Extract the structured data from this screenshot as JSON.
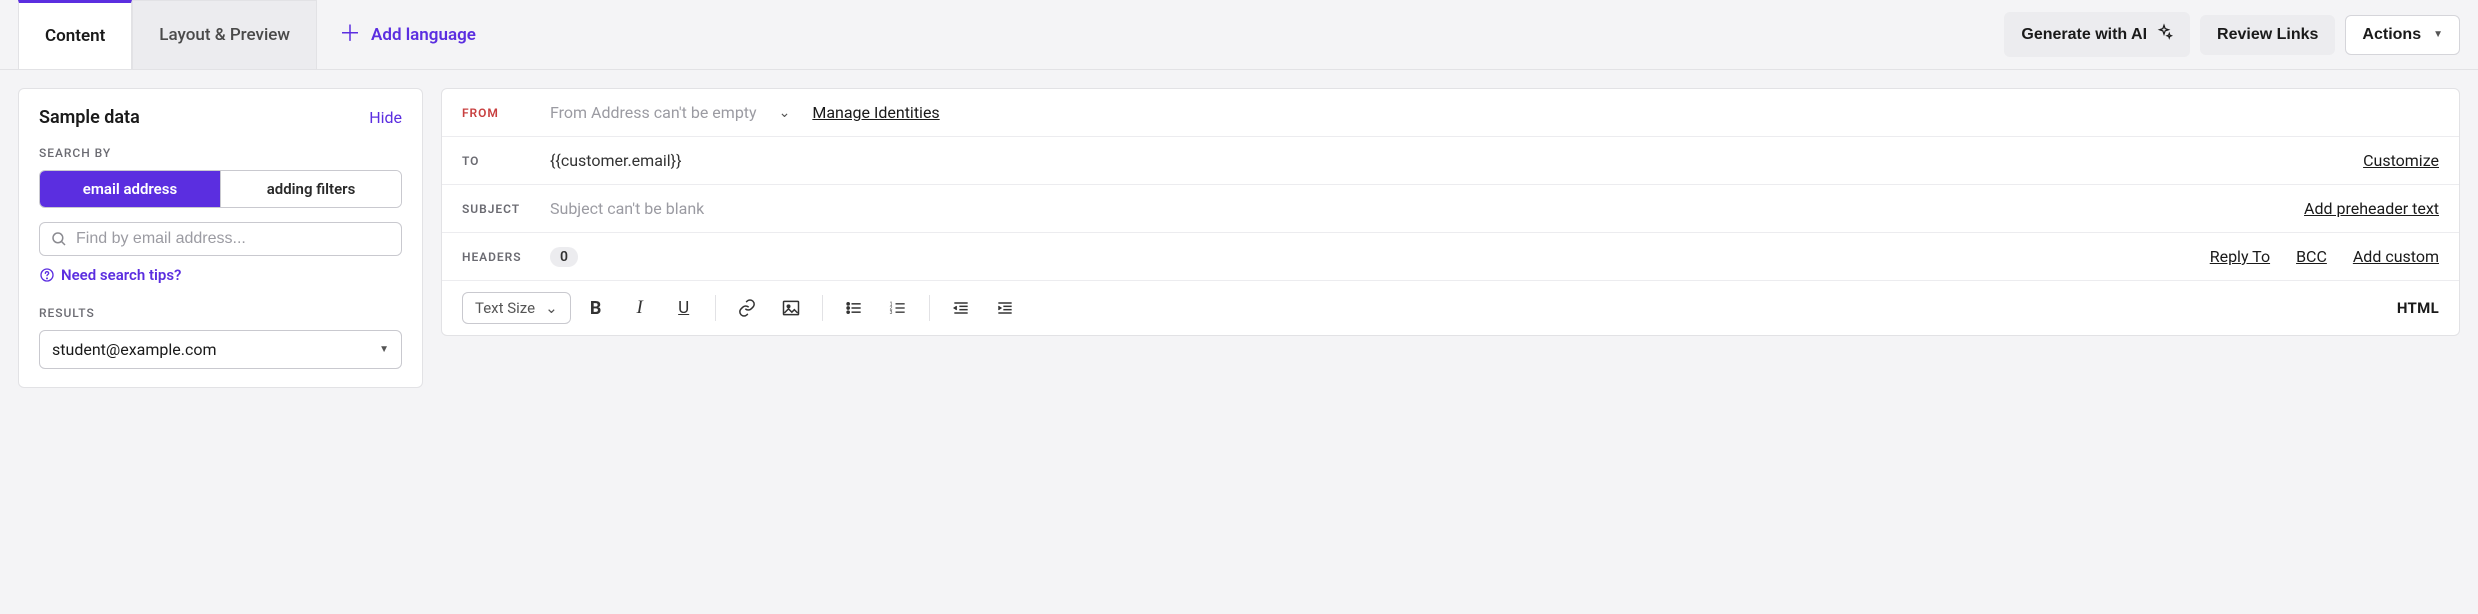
{
  "tabs": {
    "content": "Content",
    "layout_preview": "Layout & Preview"
  },
  "add_language": "Add language",
  "actions_bar": {
    "generate_ai": "Generate with AI",
    "review_links": "Review Links",
    "actions": "Actions"
  },
  "sidebar": {
    "title": "Sample data",
    "hide": "Hide",
    "search_by_label": "SEARCH BY",
    "seg_email": "email address",
    "seg_filters": "adding filters",
    "search_placeholder": "Find by email address...",
    "tips": "Need search tips?",
    "results_label": "RESULTS",
    "result_value": "student@example.com"
  },
  "editor": {
    "from_label": "FROM",
    "from_placeholder": "From Address can't be empty",
    "manage_identities": "Manage Identities",
    "to_label": "TO",
    "to_value": "{{customer.email}}",
    "customize": "Customize",
    "subject_label": "SUBJECT",
    "subject_placeholder": "Subject can't be blank",
    "preheader": "Add preheader text",
    "headers_label": "HEADERS",
    "headers_count": "0",
    "reply_to": "Reply To",
    "bcc": "BCC",
    "add_custom": "Add custom",
    "text_size": "Text Size",
    "html_toggle": "HTML"
  }
}
